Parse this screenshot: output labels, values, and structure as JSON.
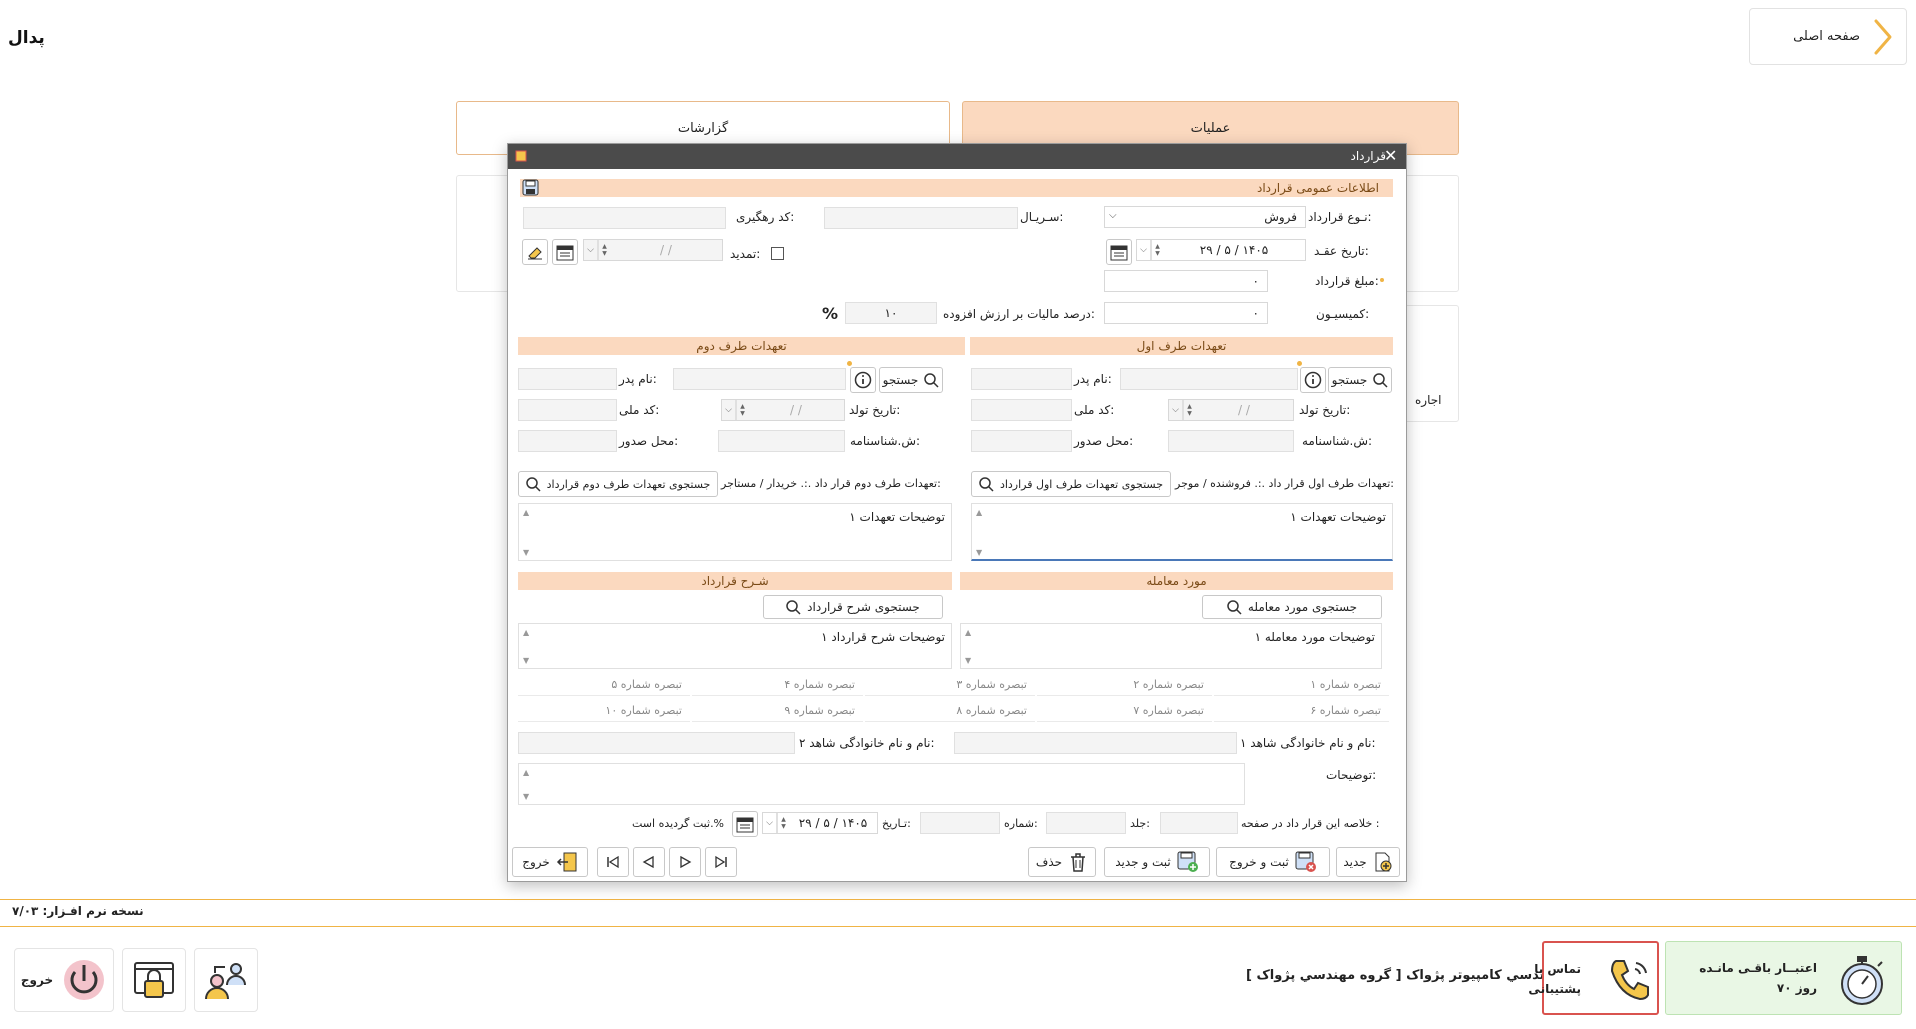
{
  "app": {
    "logo": "پدال",
    "home_label": "صفحه اصلی"
  },
  "menu": {
    "reports": "گزارشات",
    "operations": "عملیات",
    "rental_hint": "اجاره"
  },
  "footer": {
    "version": "نسخه نرم افـزار: ۷/۰۳",
    "exit": "خروج",
    "company": "شرکت مهندسي کامپيوتر پژواک [ گروه مهندسي پژواک ]",
    "support_line1": "تماس با",
    "support_line2": "پشتیبانی",
    "credit_line1": "اعتبــار باقـی مانـده",
    "credit_line2": "۷۰ روز"
  },
  "dialog": {
    "title": "قرارداد",
    "general": {
      "header": "اطلاعات عمومی قرارداد",
      "contract_type_label": "نـوع قرارداد:",
      "contract_type_value": "فروش",
      "serial_label": "سـریـال:",
      "tracking_label": "کد رهگیری:",
      "contract_date_label": "تاریخ عقـد:",
      "contract_date_value": "۲۹ / ۵ / ۱۴۰۵",
      "extend_label": "تمدید:",
      "extend_date_placeholder": "/     /",
      "amount_label": "مبلغ قرارداد:",
      "amount_value": "۰",
      "commission_label": "کمیسیـون:",
      "commission_value": "۰",
      "vat_label": "درصد مالیات بر ارزش افزوده:",
      "vat_value": "۱۰",
      "percent_symbol": "%"
    },
    "party1": {
      "header": "تعهدات طرف اول",
      "search": "جستجو",
      "father_label": "نام پدر:",
      "birth_label": "تاریخ تولد:",
      "national_label": "کد ملی:",
      "idno_label": "ش.شناسنامه:",
      "issue_label": "محل صدور:",
      "date_placeholder": "/     /",
      "commit_label": "تعهدات طرف اول قرار داد .:. فروشنده / موجر:",
      "commit_search": "جستجوی تعهدات طرف اول قرارداد",
      "commit_text": "توضیحات تعهدات ۱"
    },
    "party2": {
      "header": "تعهدات طرف دوم",
      "search": "جستجو",
      "father_label": "نام پدر:",
      "birth_label": "تاریخ تولد:",
      "national_label": "کد ملی:",
      "idno_label": "ش.شناسنامه:",
      "issue_label": "محل صدور:",
      "date_placeholder": "/     /",
      "commit_label": "تعهدات طرف دوم قرار داد .:. خریدار / مستاجر:",
      "commit_search": "جستجوی تعهدات طرف دوم قرارداد",
      "commit_text": "توضیحات تعهدات ۱"
    },
    "subject": {
      "header": "مورد معامله",
      "search": "جستجوی مورد معامله",
      "text": "توضیحات مورد معامله ۱"
    },
    "description": {
      "header": "شـرح قرارداد",
      "search": "جستجوی شرح قرارداد",
      "text": "توضیحات شرح قرارداد ۱"
    },
    "notes": [
      "تبصره شماره ۱",
      "تبصره شماره ۲",
      "تبصره شماره ۳",
      "تبصره شماره ۴",
      "تبصره شماره ۵",
      "تبصره شماره ۶",
      "تبصره شماره ۷",
      "تبصره شماره ۸",
      "تبصره شماره ۹",
      "تبصره شماره ۱۰"
    ],
    "witness1_label": "نام و نام خانوادگی شاهد ۱:",
    "witness2_label": "نام و نام خانوادگی شاهد ۲:",
    "remarks_label": "توضیحات:",
    "summary": {
      "prefix": "خلاصه این قرار داد در صفحه :",
      "volume": "جلد:",
      "number": "شماره:",
      "date": "تـاریخ:",
      "date_value": "۲۹ / ۵ / ۱۴۰۵",
      "suffix": "ثبت گردیده است.%"
    },
    "buttons": {
      "new": "جدید",
      "save_exit": "ثبت و خروج",
      "save_new": "ثبت و جدید",
      "delete": "حذف",
      "exit": "خروج"
    }
  }
}
